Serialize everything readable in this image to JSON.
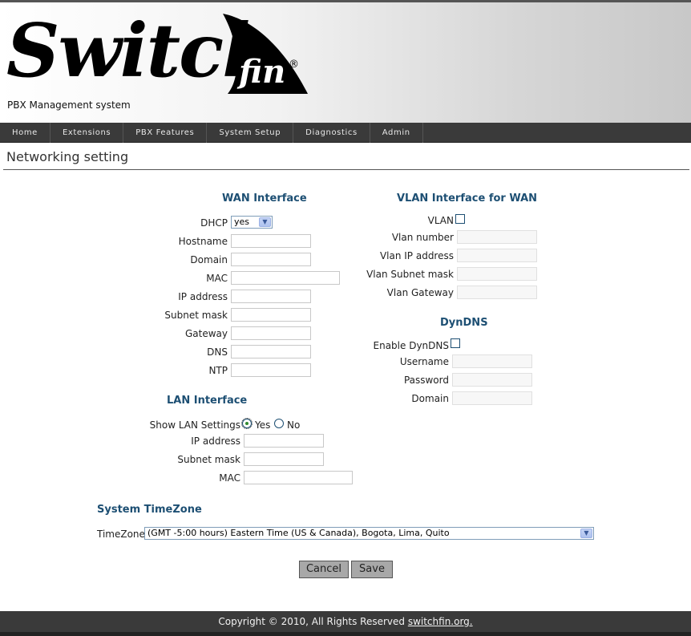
{
  "header": {
    "logo_text": "Switch",
    "logo_fin": "fin",
    "logo_reg": "®",
    "tagline": "PBX Management system"
  },
  "nav": [
    {
      "label": "Home"
    },
    {
      "label": "Extensions"
    },
    {
      "label": "PBX Features"
    },
    {
      "label": "System Setup"
    },
    {
      "label": "Diagnostics"
    },
    {
      "label": "Admin"
    }
  ],
  "page_title": "Networking setting",
  "wan": {
    "title": "WAN Interface",
    "dhcp_label": "DHCP",
    "dhcp_value": "yes",
    "hostname_label": "Hostname",
    "domain_label": "Domain",
    "mac_label": "MAC",
    "ip_label": "IP address",
    "subnet_label": "Subnet mask",
    "gateway_label": "Gateway",
    "dns_label": "DNS",
    "ntp_label": "NTP"
  },
  "lan": {
    "title": "LAN Interface",
    "show_label": "Show LAN Settings",
    "yes_label": "Yes",
    "no_label": "No",
    "ip_label": "IP address",
    "subnet_label": "Subnet mask",
    "mac_label": "MAC"
  },
  "vlan": {
    "title": "VLAN Interface for WAN",
    "vlan_label": "VLAN",
    "number_label": "Vlan number",
    "ip_label": "Vlan IP address",
    "subnet_label": "Vlan Subnet mask",
    "gateway_label": "Vlan Gateway"
  },
  "dyndns": {
    "title": "DynDNS",
    "enable_label": "Enable DynDNS",
    "username_label": "Username",
    "password_label": "Password",
    "domain_label": "Domain"
  },
  "timezone": {
    "title": "System TimeZone",
    "label": "TimeZone",
    "value": "(GMT -5:00 hours) Eastern Time (US & Canada), Bogota, Lima, Quito"
  },
  "buttons": {
    "cancel": "Cancel",
    "save": "Save"
  },
  "footer": {
    "copyright": "Copyright © 2010, All Rights Reserved ",
    "link": "switchfin.org."
  }
}
